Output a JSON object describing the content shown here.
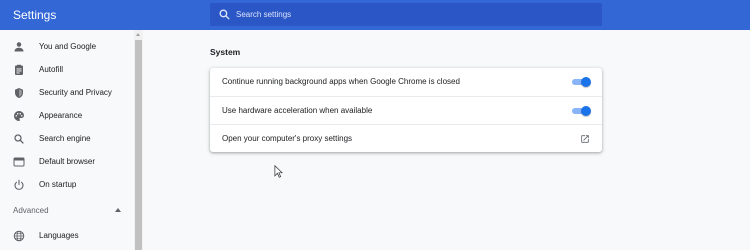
{
  "app": {
    "title": "Settings"
  },
  "search": {
    "placeholder": "Search settings",
    "icon": "search-icon"
  },
  "sidebar": {
    "items": [
      {
        "label": "You and Google",
        "icon": "person-icon"
      },
      {
        "label": "Autofill",
        "icon": "clipboard-icon"
      },
      {
        "label": "Security and Privacy",
        "icon": "shield-icon"
      },
      {
        "label": "Appearance",
        "icon": "palette-icon"
      },
      {
        "label": "Search engine",
        "icon": "search-icon"
      },
      {
        "label": "Default browser",
        "icon": "browser-icon"
      },
      {
        "label": "On startup",
        "icon": "power-icon"
      }
    ],
    "advanced": {
      "label": "Advanced",
      "expanded": true
    },
    "advanced_items": [
      {
        "label": "Languages",
        "icon": "globe-icon"
      }
    ]
  },
  "main": {
    "section_title": "System",
    "rows": [
      {
        "label": "Continue running background apps when Google Chrome is closed",
        "type": "toggle",
        "checked": true
      },
      {
        "label": "Use hardware acceleration when available",
        "type": "toggle",
        "checked": true
      },
      {
        "label": "Open your computer's proxy settings",
        "type": "external-link",
        "icon": "external-link-icon"
      }
    ]
  },
  "colors": {
    "topbar": "#3367d6",
    "search_box": "#2a56c6",
    "toggle_knob": "#1a73e8",
    "toggle_track": "#8ab4f8",
    "page_background": "#f8f9fa"
  }
}
